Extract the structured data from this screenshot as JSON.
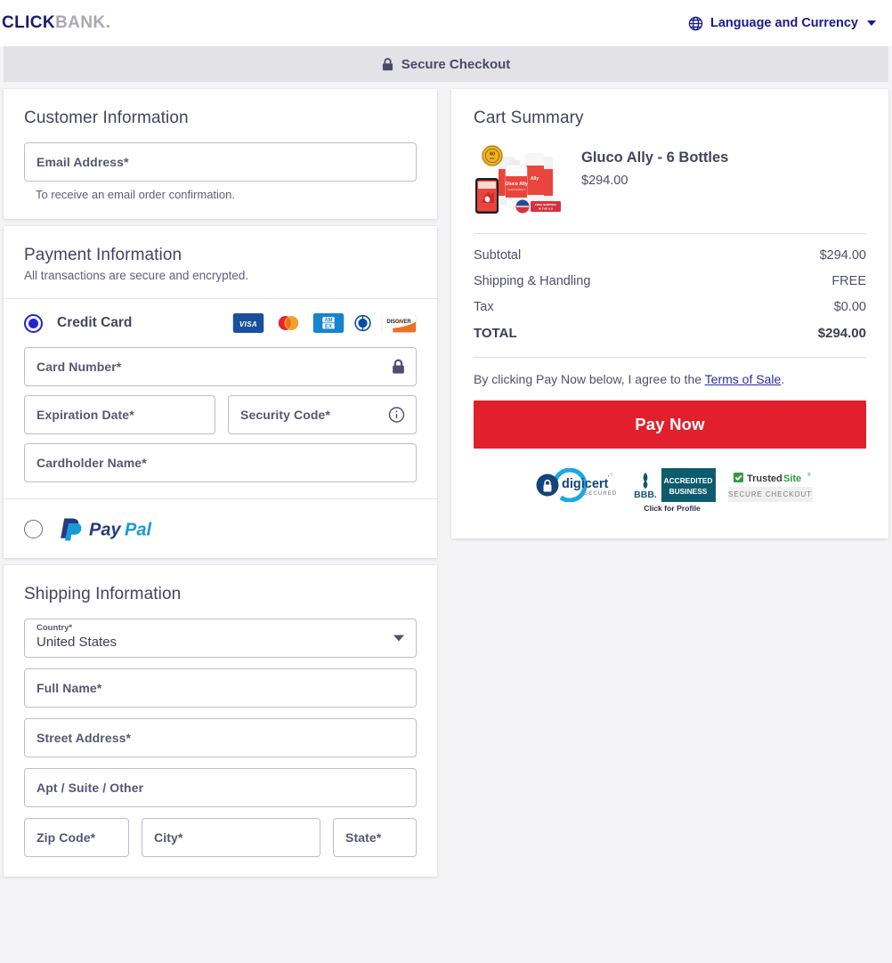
{
  "header": {
    "logo_primary": "CLICK",
    "logo_secondary": "BANK",
    "logo_dot": ".",
    "language_label": "Language and Currency",
    "globe_icon": "globe-icon",
    "caret_icon": "chevron-down-icon"
  },
  "secure_band": {
    "label": "Secure Checkout",
    "lock_icon": "lock-icon"
  },
  "customer": {
    "title": "Customer Information",
    "email_placeholder": "Email Address*",
    "email_value": "",
    "helper": "To receive an email order confirmation."
  },
  "payment": {
    "title": "Payment Information",
    "subtitle": "All transactions are secure and encrypted.",
    "methods": [
      {
        "id": "credit-card",
        "label": "Credit Card",
        "selected": true
      },
      {
        "id": "paypal",
        "label": "PayPal",
        "selected": false
      }
    ],
    "card_brands": [
      "visa",
      "mastercard",
      "amex",
      "diners-club",
      "discover"
    ],
    "fields": {
      "card_number_placeholder": "Card Number*",
      "card_number_value": "",
      "expiration_placeholder": "Expiration Date*",
      "expiration_value": "",
      "security_code_placeholder": "Security Code*",
      "security_code_value": "",
      "cardholder_placeholder": "Cardholder Name*",
      "cardholder_value": ""
    },
    "lock_icon": "lock-icon",
    "info_icon": "info-icon"
  },
  "shipping": {
    "title": "Shipping Information",
    "country_label": "Country*",
    "country_value": "United States",
    "fields": [
      {
        "name": "full-name",
        "placeholder": "Full Name*",
        "value": ""
      },
      {
        "name": "street-address",
        "placeholder": "Street Address*",
        "value": ""
      },
      {
        "name": "apt-suite-other",
        "placeholder": "Apt / Suite / Other",
        "value": ""
      }
    ],
    "row_fields": [
      {
        "name": "zip-code",
        "placeholder": "Zip Code*",
        "value": ""
      },
      {
        "name": "city",
        "placeholder": "City*",
        "value": ""
      },
      {
        "name": "state",
        "placeholder": "State*",
        "value": ""
      }
    ]
  },
  "cart": {
    "title": "Cart Summary",
    "item": {
      "name": "Gluco Ally - 6 Bottles",
      "price": "$294.00"
    },
    "totals": [
      {
        "label": "Subtotal",
        "value": "$294.00"
      },
      {
        "label": "Shipping & Handling",
        "value": "FREE"
      },
      {
        "label": "Tax",
        "value": "$0.00"
      }
    ],
    "grand_total": {
      "label": "TOTAL",
      "value": "$294.00"
    },
    "agree_prefix": "By clicking Pay Now below, I agree to the ",
    "agree_link": "Terms of Sale",
    "agree_suffix": ".",
    "pay_button": "Pay Now",
    "badges": [
      {
        "name": "digicert",
        "line1": "digicert",
        "line2": "SECURED"
      },
      {
        "name": "bbb-accredited-business",
        "line1": "ACCREDITED",
        "line2": "BUSINESS",
        "line3": "BBB.",
        "caption": "Click for Profile"
      },
      {
        "name": "trustedsite",
        "line1": "Trusted",
        "line2": "Site",
        "line3": "SECURE CHECKOUT"
      }
    ]
  },
  "colors": {
    "accent_red": "#e11f2d",
    "brand_navy": "#1a1a6e",
    "radio_blue": "#2323d6",
    "text_slate": "#444461",
    "band_grey": "#e2e2e7"
  }
}
